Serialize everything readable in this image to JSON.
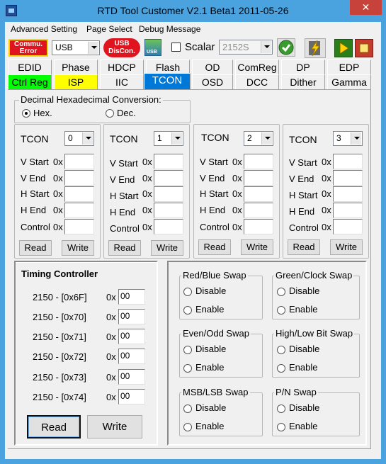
{
  "window": {
    "title": "RTD Tool Customer V2.1 Beta1   2011-05-26",
    "close_glyph": "✕"
  },
  "menu": [
    "Advanced Setting",
    "Page Select",
    "Debug Message"
  ],
  "toolbar": {
    "commu_error": "Commu.\nError",
    "commu_line1": "Commu.",
    "commu_line2": "Error",
    "interface_value": "USB",
    "usb_disconnect_line1": "USB",
    "usb_disconnect_line2": "DisCon.",
    "usb_icon_label": "USB",
    "scalar_label": "Scalar",
    "scalar_value": "2152S"
  },
  "tabs_row1": [
    "EDID",
    "Phase",
    "HDCP",
    "Flash",
    "OD",
    "ComReg",
    "DP",
    "EDP"
  ],
  "tabs_row2": [
    "Ctrl Reg",
    "ISP",
    "IIC",
    "TCON",
    "OSD",
    "DCC",
    "Dither",
    "Gamma"
  ],
  "active_tab": "TCON",
  "conversion": {
    "legend": "Decimal Hexadecimal Conversion:",
    "hex_label": "Hex.",
    "dec_label": "Dec.",
    "selected": "Hex."
  },
  "tcon_panels": [
    {
      "label": "TCON",
      "index": "0"
    },
    {
      "label": "TCON",
      "index": "1"
    },
    {
      "label": "TCON",
      "index": "2"
    },
    {
      "label": "TCON",
      "index": "3"
    }
  ],
  "tcon_fields": [
    "V Start",
    "V End",
    "H Start",
    "H End",
    "Control"
  ],
  "hex_prefix": "0x",
  "read_label": "Read",
  "write_label": "Write",
  "timing": {
    "title": "Timing Controller",
    "rows": [
      {
        "reg": "2150 - [0x6F]",
        "value": "00"
      },
      {
        "reg": "2150 - [0x70]",
        "value": "00"
      },
      {
        "reg": "2150 - [0x71]",
        "value": "00"
      },
      {
        "reg": "2150 - [0x72]",
        "value": "00"
      },
      {
        "reg": "2150 - [0x73]",
        "value": "00"
      },
      {
        "reg": "2150 - [0x74]",
        "value": "00"
      }
    ],
    "read_label": "Read",
    "write_label": "Write"
  },
  "swaps": [
    {
      "legend": "Red/Blue Swap"
    },
    {
      "legend": "Green/Clock Swap"
    },
    {
      "legend": "Even/Odd Swap"
    },
    {
      "legend": "High/Low Bit Swap"
    },
    {
      "legend": "MSB/LSB Swap"
    },
    {
      "legend": "P/N Swap"
    }
  ],
  "disable_label": "Disable",
  "enable_label": "Enable",
  "colors": {
    "active_tab": "#0078d7",
    "ctrl_reg_tab": "#00ff00",
    "isp_tab": "#ffff00",
    "error_red": "#e0141e",
    "title_bar": "#4aa3df"
  }
}
